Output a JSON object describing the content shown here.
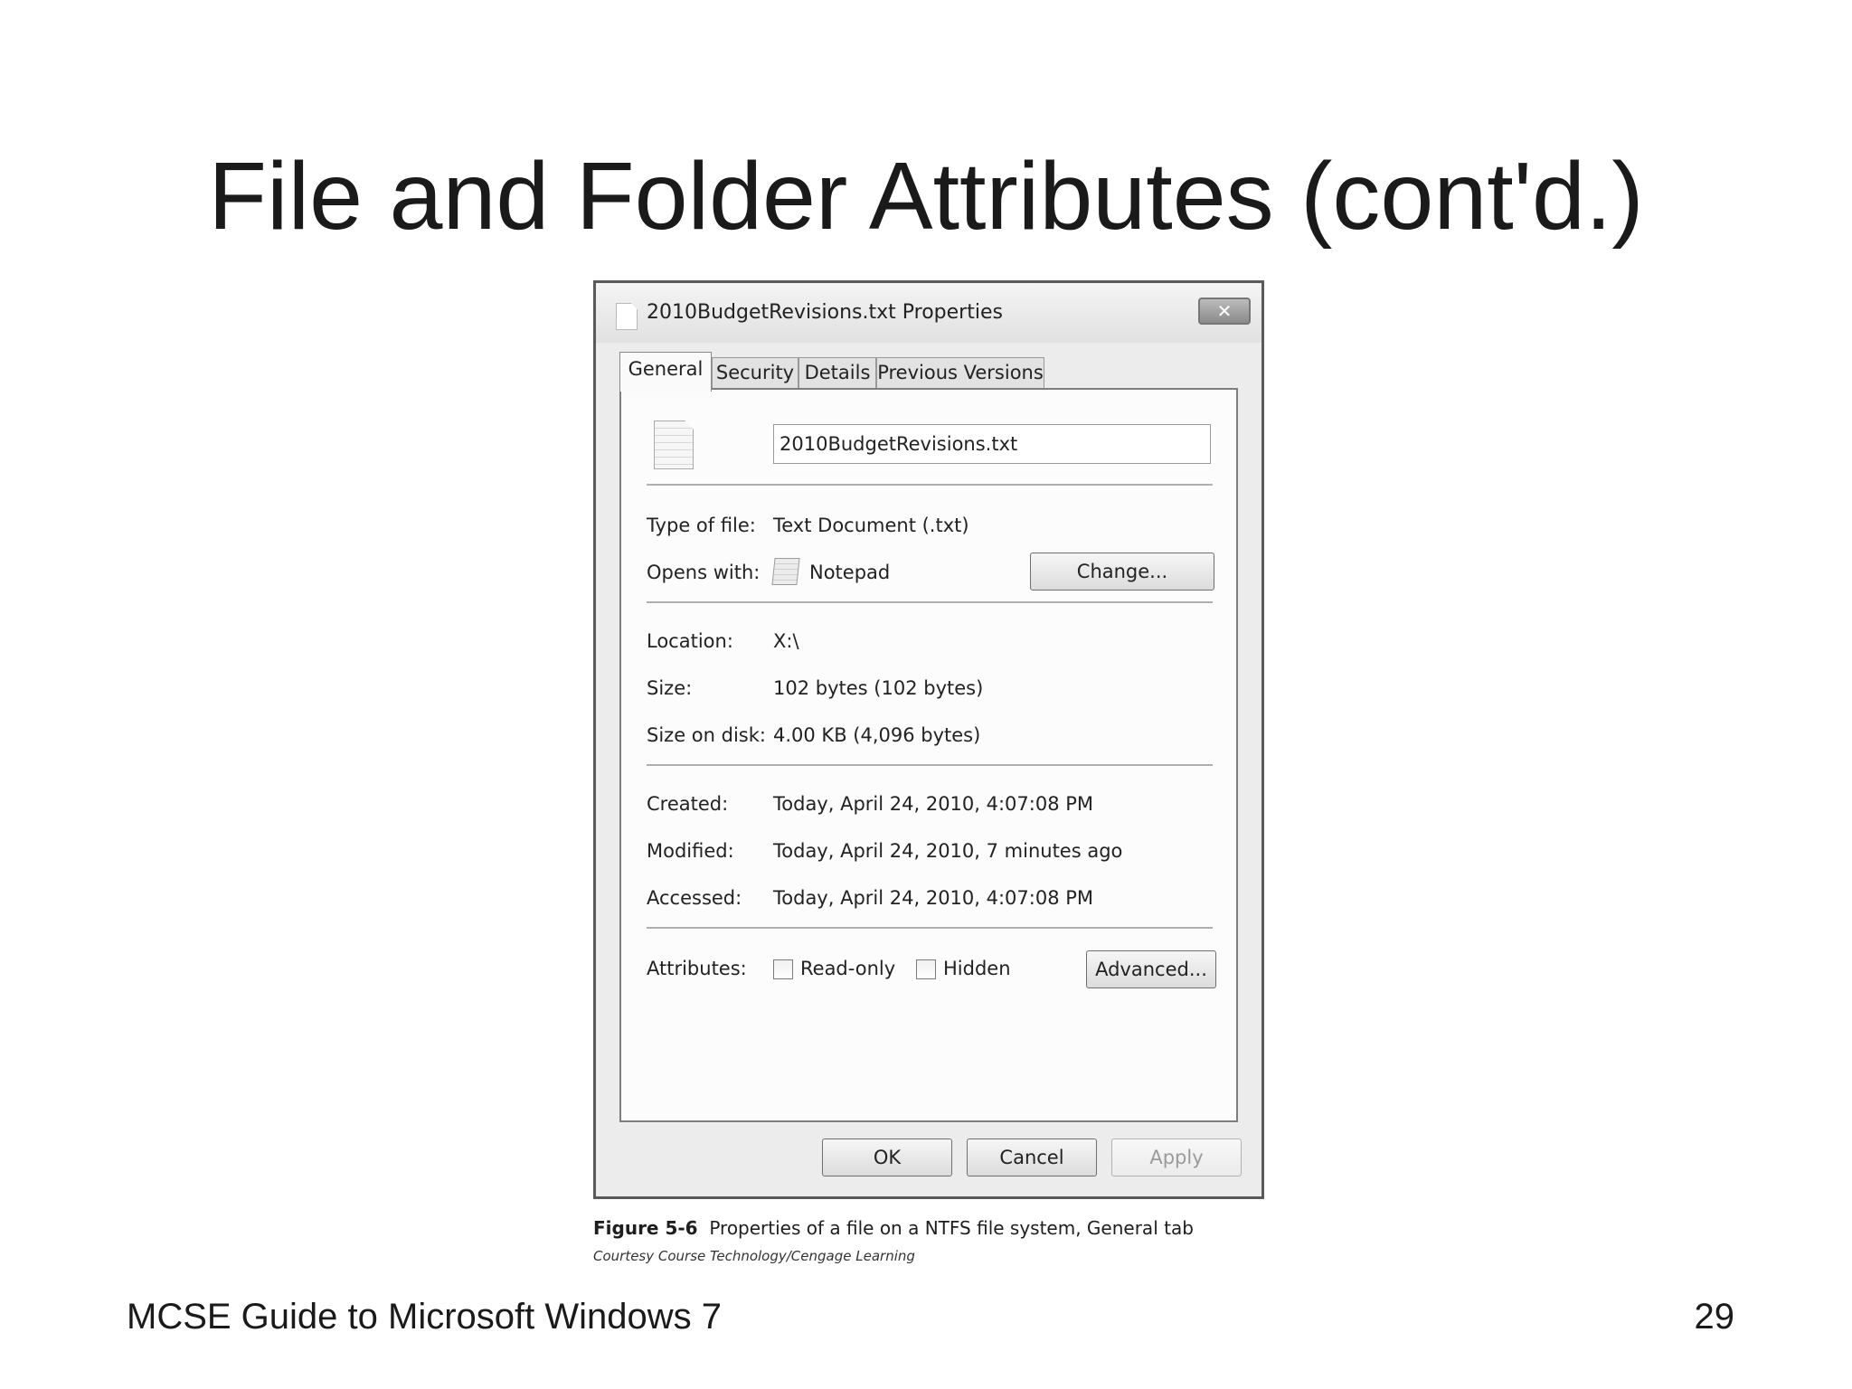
{
  "slide": {
    "title": "File and Folder Attributes (cont'd.)",
    "footer_left": "MCSE Guide to Microsoft Windows 7",
    "page_number": "29"
  },
  "dialog": {
    "window_title": "2010BudgetRevisions.txt Properties",
    "close_glyph": "✕",
    "tabs": [
      {
        "label": "General",
        "active": true
      },
      {
        "label": "Security",
        "active": false
      },
      {
        "label": "Details",
        "active": false
      },
      {
        "label": "Previous Versions",
        "active": false
      }
    ],
    "file_name": "2010BudgetRevisions.txt",
    "type_of_file": {
      "label": "Type of file:",
      "value": "Text Document (.txt)"
    },
    "opens_with": {
      "label": "Opens with:",
      "value": "Notepad",
      "button": "Change..."
    },
    "location": {
      "label": "Location:",
      "value": "X:\\"
    },
    "size": {
      "label": "Size:",
      "value": "102 bytes (102 bytes)"
    },
    "size_on_disk": {
      "label": "Size on disk:",
      "value": "4.00 KB (4,096 bytes)"
    },
    "created": {
      "label": "Created:",
      "value": "Today, April 24, 2010, 4:07:08 PM"
    },
    "modified": {
      "label": "Modified:",
      "value": "Today, April 24, 2010, 7 minutes ago"
    },
    "accessed": {
      "label": "Accessed:",
      "value": "Today, April 24, 2010, 4:07:08 PM"
    },
    "attributes": {
      "label": "Attributes:",
      "read_only": {
        "label": "Read-only",
        "checked": false
      },
      "hidden": {
        "label": "Hidden",
        "checked": false
      },
      "advanced_button": "Advanced..."
    },
    "buttons": {
      "ok": "OK",
      "cancel": "Cancel",
      "apply": "Apply",
      "apply_enabled": false
    }
  },
  "caption": {
    "figure_number": "Figure 5-6",
    "text": "Properties of a file on a NTFS file system, General tab",
    "credit": "Courtesy Course Technology/Cengage Learning"
  }
}
